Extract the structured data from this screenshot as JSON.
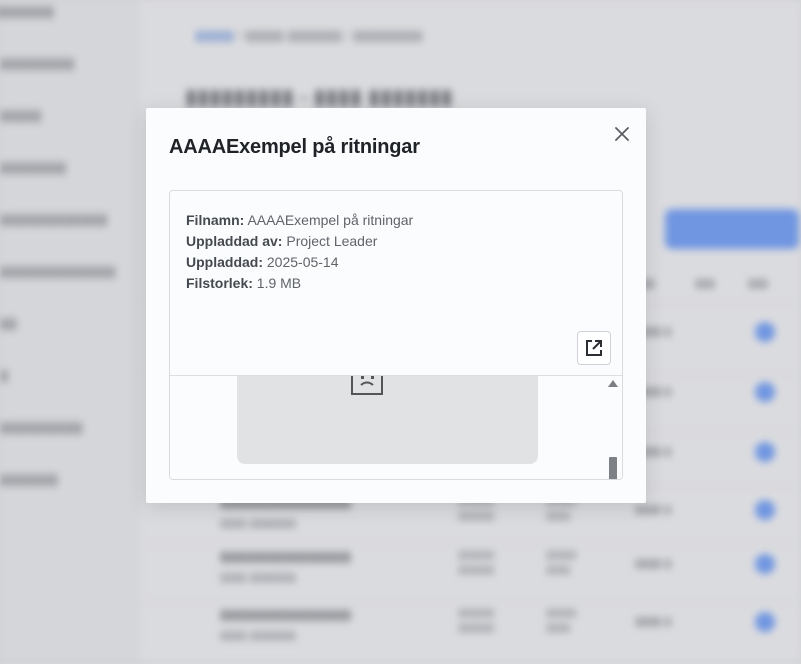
{
  "modal": {
    "title": "AAAAExempel på ritningar",
    "fields": [
      {
        "label": "Filnamn:",
        "value": "AAAAExempel på ritningar"
      },
      {
        "label": "Uppladdad av:",
        "value": "Project Leader"
      },
      {
        "label": "Uppladdad:",
        "value": "2025-05-14"
      },
      {
        "label": "Filstorlek:",
        "value": "1.9 MB"
      }
    ],
    "icons": {
      "close": "close-icon",
      "open_external": "open-external-icon",
      "preview": "broken-document-icon",
      "scroll_up": "scroll-up-arrow"
    }
  },
  "colors": {
    "accent": "#5d8be6",
    "modal_bg": "#fbfcfd",
    "title_text": "#1f2227"
  }
}
